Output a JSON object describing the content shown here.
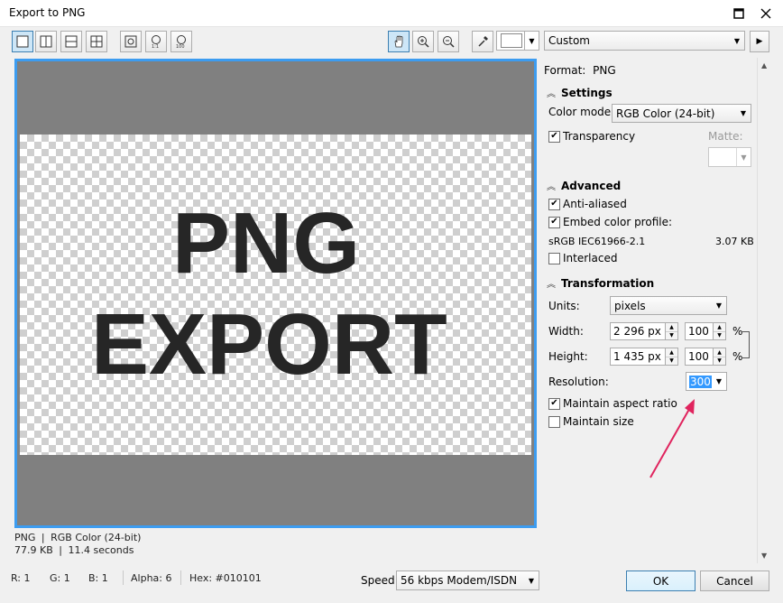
{
  "window": {
    "title": "Export to PNG"
  },
  "toolbar": {
    "preset": "Custom"
  },
  "preview": {
    "text_line1": "PNG",
    "text_line2": "EXPORT",
    "info_format": "PNG",
    "info_color": "RGB Color (24-bit)",
    "info_size": "77.9 KB",
    "info_time": "11.4 seconds",
    "separator": "|"
  },
  "panel": {
    "format_label": "Format:",
    "format_value": "PNG",
    "settings": {
      "heading": "Settings",
      "color_mode_label": "Color mode:",
      "color_mode_value": "RGB Color (24-bit)",
      "transparency_label": "Transparency",
      "transparency_checked": true,
      "matte_label": "Matte:"
    },
    "advanced": {
      "heading": "Advanced",
      "anti_aliased_label": "Anti-aliased",
      "anti_aliased_checked": true,
      "embed_profile_label": "Embed color profile:",
      "embed_profile_checked": true,
      "profile_name": "sRGB IEC61966-2.1",
      "profile_size": "3.07 KB",
      "interlaced_label": "Interlaced",
      "interlaced_checked": false
    },
    "transformation": {
      "heading": "Transformation",
      "units_label": "Units:",
      "units_value": "pixels",
      "width_label": "Width:",
      "width_value": "2 296 px",
      "width_percent": "100",
      "height_label": "Height:",
      "height_value": "1 435 px",
      "height_percent": "100",
      "percent_sign": "%",
      "resolution_label": "Resolution:",
      "resolution_value": "300",
      "maintain_aspect_label": "Maintain aspect ratio",
      "maintain_aspect_checked": true,
      "maintain_size_label": "Maintain size",
      "maintain_size_checked": false
    }
  },
  "statusbar": {
    "r": "R: 1",
    "g": "G: 1",
    "b": "B: 1",
    "alpha": "Alpha: 6",
    "hex": "Hex: #010101",
    "speed_label": "Speed:",
    "speed_value": "56 kbps Modem/ISDN"
  },
  "buttons": {
    "ok": "OK",
    "cancel": "Cancel"
  },
  "colors": {
    "accent": "#3c9cf0",
    "annotation_arrow": "#e0245e",
    "preview_gray": "#808080"
  }
}
